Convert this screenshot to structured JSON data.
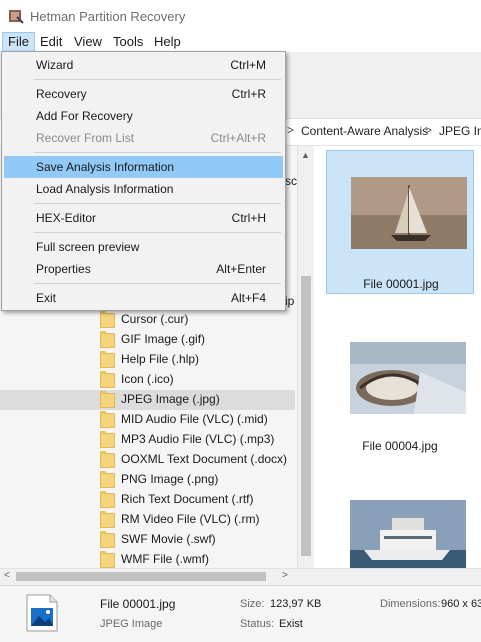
{
  "window": {
    "title": "Hetman Partition Recovery",
    "colors": {
      "menu_highlight": "#91c9f7",
      "selection": "#cce4f7",
      "folder": "#f4d47c"
    }
  },
  "menubar": {
    "file": "File",
    "edit": "Edit",
    "view": "View",
    "tools": "Tools",
    "help": "Help"
  },
  "file_menu": {
    "wizard": {
      "label": "Wizard",
      "shortcut": "Ctrl+M"
    },
    "recovery": {
      "label": "Recovery",
      "shortcut": "Ctrl+R"
    },
    "add_for_recovery": {
      "label": "Add For Recovery"
    },
    "recover_from_list": {
      "label": "Recover From List",
      "shortcut": "Ctrl+Alt+R",
      "disabled": true
    },
    "save_analysis": {
      "label": "Save Analysis Information"
    },
    "load_analysis": {
      "label": "Load Analysis Information"
    },
    "hex_editor": {
      "label": "HEX-Editor",
      "shortcut": "Ctrl+H"
    },
    "full_screen_preview": {
      "label": "Full screen preview"
    },
    "properties": {
      "label": "Properties",
      "shortcut": "Alt+Enter"
    },
    "exit": {
      "label": "Exit",
      "shortcut": "Alt+F4"
    }
  },
  "breadcrumb": {
    "sep1": ">",
    "item1": "Content-Aware Analysis",
    "sep2": ">",
    "item2": "JPEG Ima"
  },
  "tree": {
    "partial_top": "sc",
    "partial_mid": "ip",
    "items": [
      "Cursor (.cur)",
      "GIF Image (.gif)",
      "Help File (.hlp)",
      "Icon (.ico)",
      "JPEG Image (.jpg)",
      "MID Audio File (VLC) (.mid)",
      "MP3 Audio File (VLC) (.mp3)",
      "OOXML Text Document (.docx)",
      "PNG Image (.png)",
      "Rich Text Document (.rtf)",
      "RM Video File (VLC) (.rm)",
      "SWF Movie (.swf)",
      "WMF File (.wmf)"
    ],
    "selected_index": 4
  },
  "files": [
    {
      "name": "File 00001.jpg",
      "thumb": "sailboat-photo",
      "selected": true
    },
    {
      "name": "File 00004.jpg",
      "thumb": "yacht-rope-photo",
      "selected": false
    },
    {
      "name": "",
      "thumb": "cruise-ship-photo",
      "selected": false
    }
  ],
  "status": {
    "file_name": "File 00001.jpg",
    "file_type": "JPEG Image",
    "size_label": "Size:",
    "size_value": "123,97 KB",
    "status_label": "Status:",
    "status_value": "Exist",
    "dimensions_label": "Dimensions:",
    "dimensions_value": "960 x 63"
  },
  "icons": [
    "app-icon",
    "folder-icon",
    "image-file-icon",
    "arrow-left-icon",
    "arrow-right-icon",
    "arrow-up-icon"
  ]
}
